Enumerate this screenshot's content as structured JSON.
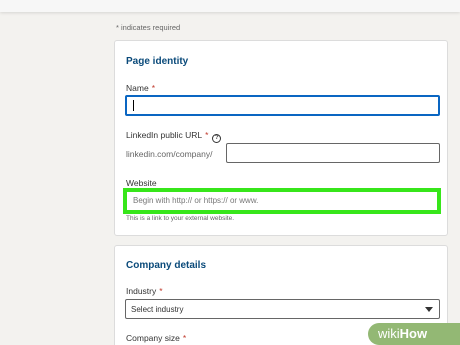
{
  "required_note": "* indicates required",
  "page_identity": {
    "title": "Page identity",
    "name_label": "Name",
    "name_value": "",
    "url_label": "LinkedIn public URL",
    "url_prefix": "linkedin.com/company/",
    "url_value": "",
    "website_label": "Website",
    "website_placeholder": "Begin with http:// or https:// or www.",
    "website_help": "This is a link to your external website."
  },
  "company_details": {
    "title": "Company details",
    "industry_label": "Industry",
    "industry_selected": "Select industry",
    "size_label": "Company size"
  },
  "required_marker": "*",
  "help_icon_glyph": "?",
  "watermark": {
    "wiki": "wiki",
    "how": "How"
  },
  "colors": {
    "highlight": "#37e61a",
    "focus": "#0a66c2",
    "section_title": "#0a4a7a"
  }
}
